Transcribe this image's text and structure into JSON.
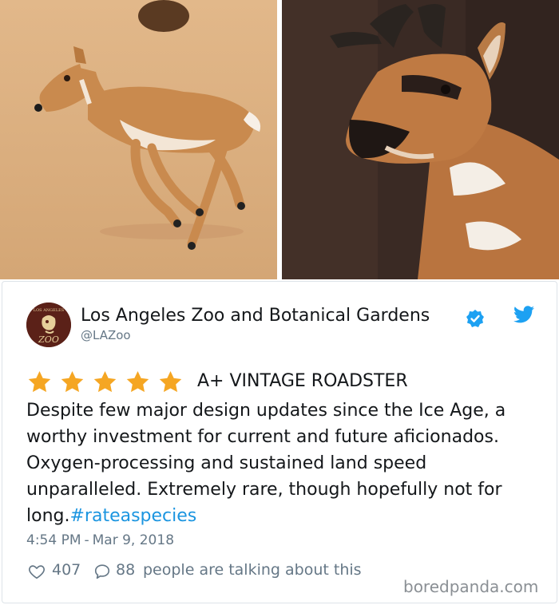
{
  "tweet": {
    "account_name": "Los Angeles Zoo and Botanical Gardens",
    "handle": "@LAZoo",
    "avatar_text": {
      "top": "LOS ANGELES",
      "bottom": "ZOO"
    },
    "rating": 5,
    "headline": "A+ VINTAGE ROADSTER",
    "body": "Despite few major design updates since the Ice Age, a worthy investment for current and future aficionados. Oxygen-processing and sustained land speed unparalleled. Extremely rare, though hopefully not for long.",
    "hashtag": "#rateaspecies",
    "time": "4:54 PM",
    "date": "Mar 9, 2018",
    "likes": "407",
    "replies": "88",
    "talking_text": "people are talking about this"
  },
  "watermark": "boredpanda.com",
  "colors": {
    "link": "#1b95e0",
    "star": "#f5a623",
    "text": "#14171a",
    "muted": "#657786"
  },
  "icons": [
    "verified-badge-icon",
    "twitter-bird-icon",
    "heart-icon",
    "reply-bubble-icon",
    "star-icon"
  ]
}
